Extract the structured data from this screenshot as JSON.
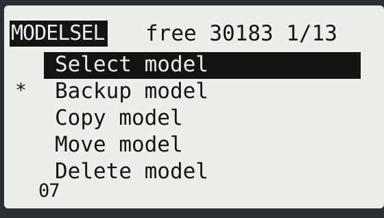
{
  "header": {
    "title": "MODELSEL",
    "free_label": "free",
    "free_value": "30183",
    "page": "1/13"
  },
  "menu": {
    "items": [
      {
        "label": "Select model",
        "selected": true
      },
      {
        "label": "Backup model",
        "selected": false
      },
      {
        "label": "Copy model",
        "selected": false
      },
      {
        "label": "Move model",
        "selected": false
      },
      {
        "label": "Delete model",
        "selected": false
      }
    ]
  },
  "current_model_marker": "*",
  "model_number": "07"
}
